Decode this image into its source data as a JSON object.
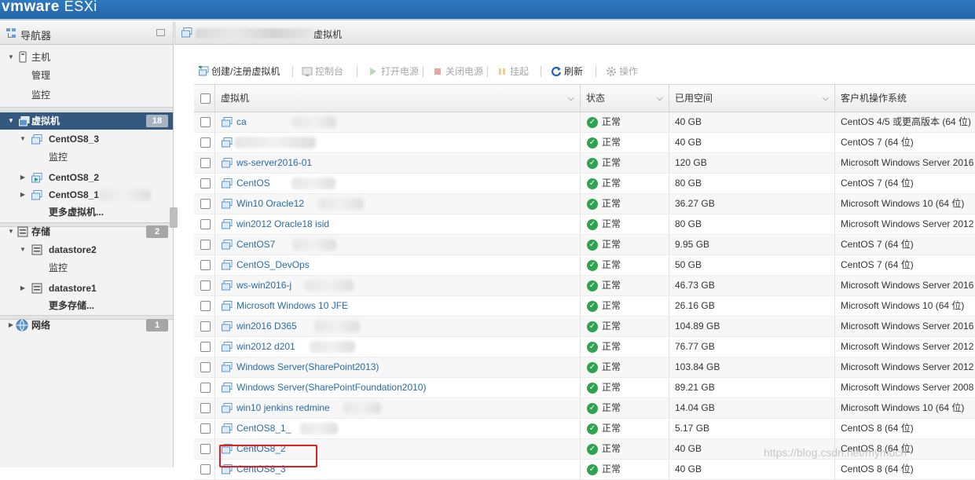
{
  "app": {
    "brand_vm": "vmware",
    "brand_product": "ESXi"
  },
  "navigator": {
    "title": "导航器",
    "host": {
      "label": "主机",
      "children": [
        "管理",
        "监控"
      ]
    },
    "vms": {
      "label": "虚拟机",
      "count": "18",
      "items": [
        {
          "label": "CentOS8_3",
          "children": [
            "监控"
          ]
        },
        {
          "label": "CentOS8_2"
        },
        {
          "label": "CentOS8_1"
        }
      ],
      "more": "更多虚拟机..."
    },
    "storage": {
      "label": "存储",
      "count": "2",
      "items": [
        {
          "label": "datastore2",
          "children": [
            "监控"
          ]
        },
        {
          "label": "datastore1"
        }
      ],
      "more": "更多存储..."
    },
    "network": {
      "label": "网络",
      "count": "1"
    }
  },
  "main": {
    "title": "虚拟机",
    "toolbar": {
      "create": "创建/注册虚拟机",
      "console": "控制台",
      "power_on": "打开电源",
      "power_off": "关闭电源",
      "suspend": "挂起",
      "refresh": "刷新",
      "actions": "操作"
    },
    "columns": [
      "虚拟机",
      "状态",
      "已用空间",
      "客户机操作系统"
    ],
    "rows": [
      {
        "name": "ca",
        "status": "正常",
        "used": "40 GB",
        "os": "CentOS 4/5 或更高版本 (64 位)"
      },
      {
        "name": "",
        "status": "正常",
        "used": "40 GB",
        "os": "CentOS 7 (64 位)"
      },
      {
        "name": "ws-server2016-01",
        "status": "正常",
        "used": "120 GB",
        "os": "Microsoft Windows Server 2016"
      },
      {
        "name": "CentOS",
        "status": "正常",
        "used": "80 GB",
        "os": "CentOS 7 (64 位)"
      },
      {
        "name": "Win10 Oracle12",
        "status": "正常",
        "used": "36.27 GB",
        "os": "Microsoft Windows 10 (64 位)"
      },
      {
        "name": "win2012 Oracle18 isid",
        "status": "正常",
        "used": "80 GB",
        "os": "Microsoft Windows Server 2012"
      },
      {
        "name": "CentOS7",
        "status": "正常",
        "used": "9.95 GB",
        "os": "CentOS 7 (64 位)"
      },
      {
        "name": "CentOS_DevOps",
        "status": "正常",
        "used": "50 GB",
        "os": "CentOS 7 (64 位)"
      },
      {
        "name": "ws-win2016-j",
        "status": "正常",
        "used": "46.73 GB",
        "os": "Microsoft Windows Server 2016"
      },
      {
        "name": "Microsoft Windows 10 JFE",
        "status": "正常",
        "used": "26.16 GB",
        "os": "Microsoft Windows 10 (64 位)"
      },
      {
        "name": "win2016 D365",
        "status": "正常",
        "used": "104.89 GB",
        "os": "Microsoft Windows Server 2016"
      },
      {
        "name": "win2012 d201",
        "status": "正常",
        "used": "76.77 GB",
        "os": "Microsoft Windows Server 2012"
      },
      {
        "name": "Windows Server(SharePoint2013)",
        "status": "正常",
        "used": "103.84 GB",
        "os": "Microsoft Windows Server 2012"
      },
      {
        "name": "Windows Server(SharePointFoundation2010)",
        "status": "正常",
        "used": "89.21 GB",
        "os": "Microsoft Windows Server 2008"
      },
      {
        "name": "win10 jenkins redmine",
        "status": "正常",
        "used": "14.04 GB",
        "os": "Microsoft Windows 10 (64 位)"
      },
      {
        "name": "CentOS8_1_",
        "status": "正常",
        "used": "5.17 GB",
        "os": "CentOS 8 (64 位)"
      },
      {
        "name": "CentOS8_2",
        "status": "正常",
        "used": "40 GB",
        "os": "CentOS 8 (64 位)"
      },
      {
        "name": "CentOS8_3",
        "status": "正常",
        "used": "40 GB",
        "os": "CentOS 8 (64 位)"
      }
    ]
  },
  "watermark": "https://blog.csdn.net/mymuch"
}
